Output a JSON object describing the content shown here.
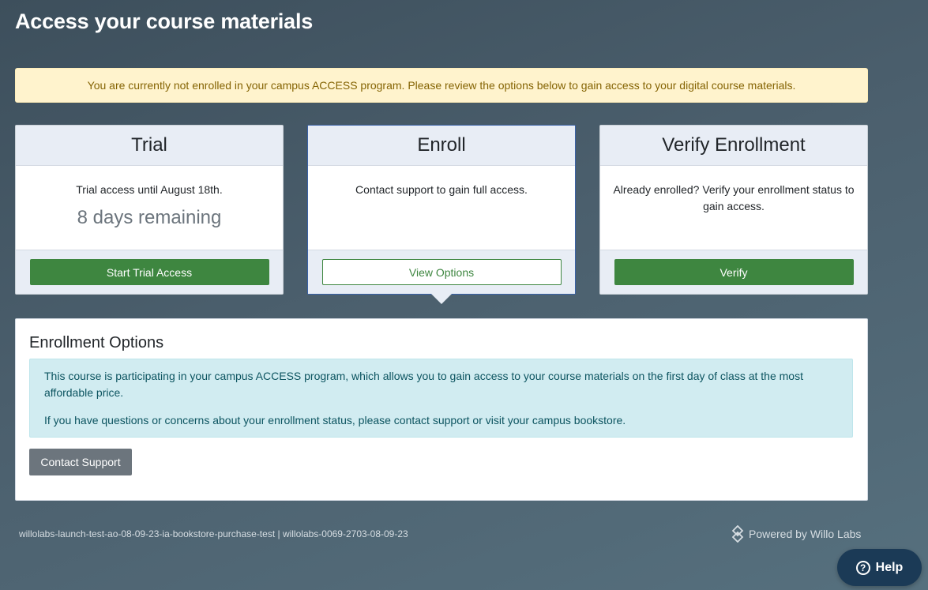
{
  "page": {
    "title": "Access your course materials"
  },
  "notice": {
    "text": "You are currently not enrolled in your campus ACCESS program. Please review the options below to gain access to your digital course materials."
  },
  "cards": {
    "trial": {
      "title": "Trial",
      "description": "Trial access until August 18th.",
      "days_remaining": "8 days remaining",
      "button_label": "Start Trial Access"
    },
    "enroll": {
      "title": "Enroll",
      "description": "Contact support to gain full access.",
      "button_label": "View Options"
    },
    "verify": {
      "title": "Verify Enrollment",
      "description": "Already enrolled? Verify your enrollment status to gain access.",
      "button_label": "Verify"
    }
  },
  "enrollment_options": {
    "title": "Enrollment Options",
    "paragraph_1": "This course is participating in your campus ACCESS program, which allows you to gain access to your course materials on the first day of class at the most affordable price.",
    "paragraph_2": "If you have questions or concerns about your enrollment status, please contact support or visit your campus bookstore.",
    "contact_button_label": "Contact Support"
  },
  "footer": {
    "ids": "willolabs-launch-test-ao-08-09-23-ia-bookstore-purchase-test | willolabs-0069-2703-08-09-23",
    "powered_by": "Powered by Willo Labs"
  },
  "help": {
    "label": "Help",
    "icon_glyph": "?"
  },
  "icons": {
    "powered_by": "willo-labs-logo-icon",
    "help": "question-circle-icon"
  },
  "colors": {
    "primary_green": "#3e8640",
    "warning_bg": "#fff3cd",
    "info_bg": "#d1ecf1",
    "help_bg": "#1b3a56",
    "secondary_gray": "#6c757d"
  }
}
